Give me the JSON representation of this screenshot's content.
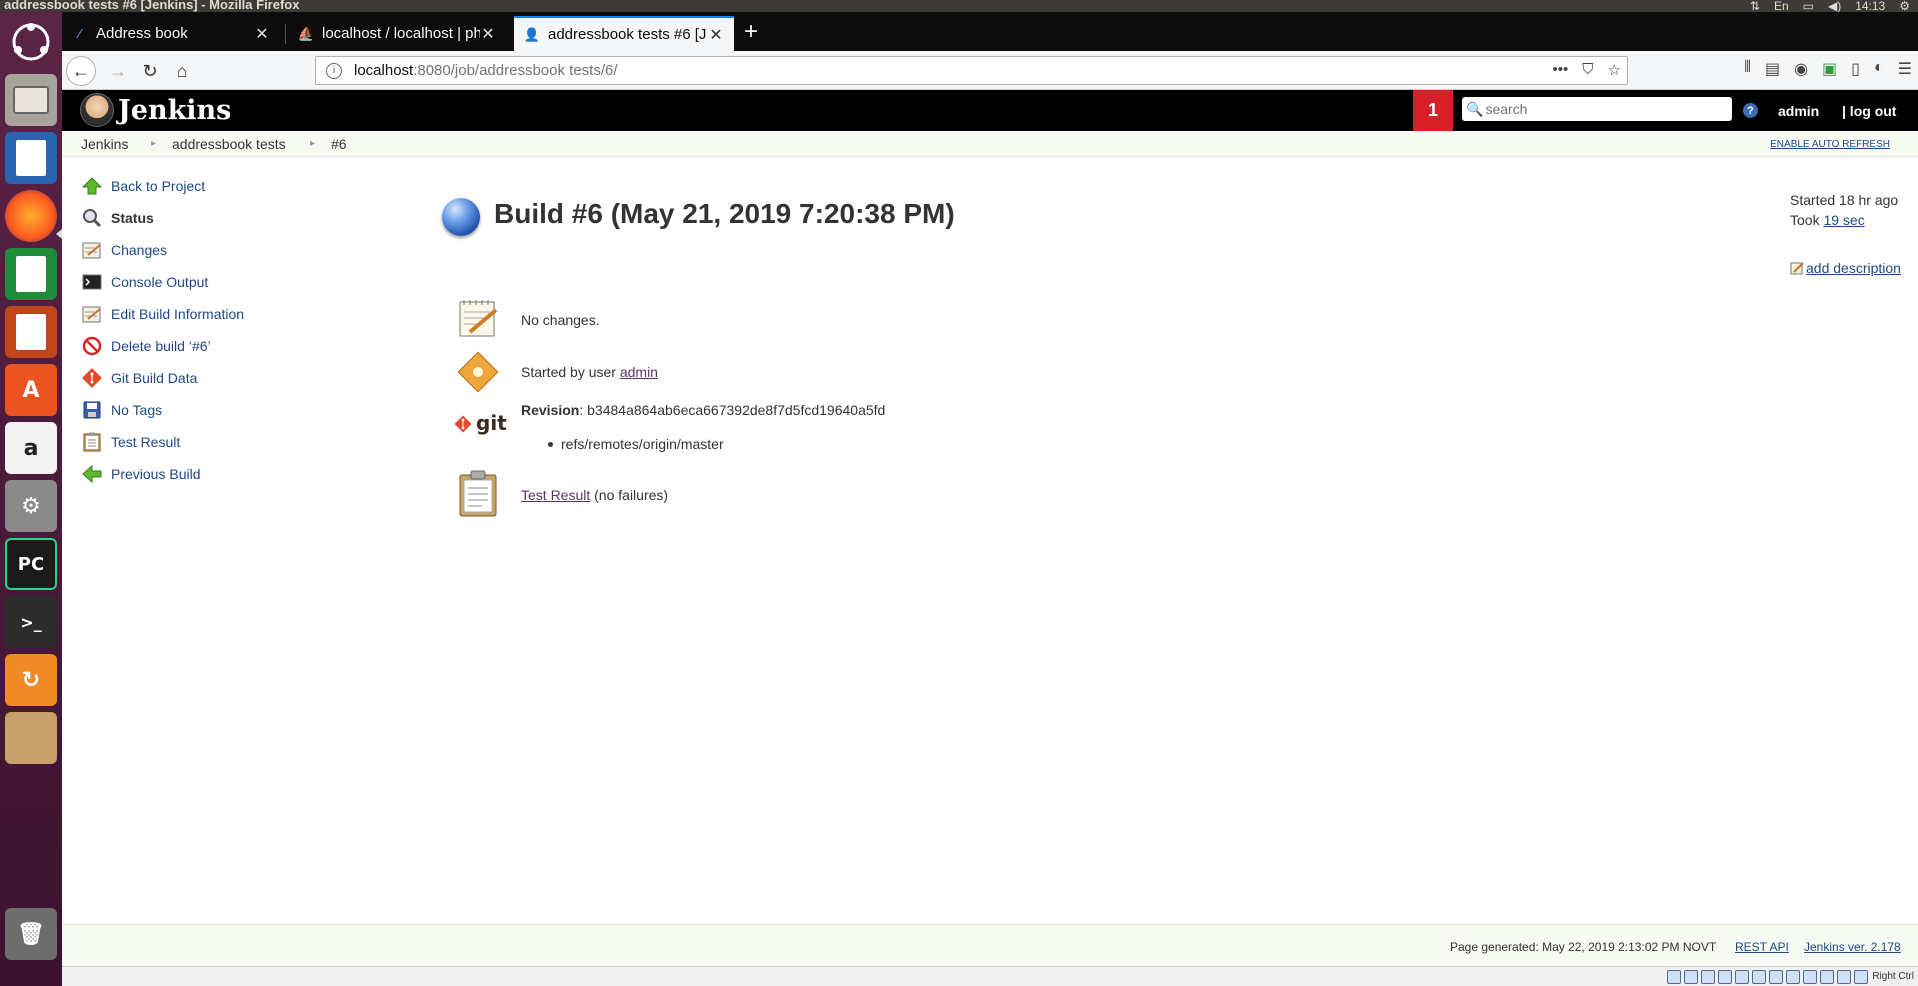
{
  "os": {
    "window_title": "addressbook tests #6 [Jenkins] - Mozilla Firefox",
    "tray": {
      "language": "En",
      "clock": "14:13"
    }
  },
  "browser": {
    "tabs": [
      {
        "label": "Address book",
        "active": false
      },
      {
        "label": "localhost / localhost | ph",
        "active": false
      },
      {
        "label": "addressbook tests #6 [J",
        "active": true
      }
    ],
    "url_host": "localhost",
    "url_rest": ":8080/job/addressbook tests/6/"
  },
  "jenkins": {
    "logo_text": "Jenkins",
    "notification_count": "1",
    "search_placeholder": "search",
    "help": "?",
    "user": "admin",
    "logout": "| log out"
  },
  "breadcrumb": {
    "items": [
      "Jenkins",
      "addressbook tests",
      "#6"
    ],
    "auto_refresh": "ENABLE AUTO REFRESH"
  },
  "side_panel": {
    "tasks": [
      {
        "label": "Back to Project",
        "icon": "up-arrow-icon"
      },
      {
        "label": "Status",
        "icon": "magnifier-icon"
      },
      {
        "label": "Changes",
        "icon": "notepad-icon"
      },
      {
        "label": "Console Output",
        "icon": "terminal-icon"
      },
      {
        "label": "Edit Build Information",
        "icon": "notepad-icon"
      },
      {
        "label": "Delete build ‘#6’",
        "icon": "no-entry-icon"
      },
      {
        "label": "Git Build Data",
        "icon": "git-icon"
      },
      {
        "label": "No Tags",
        "icon": "save-icon"
      },
      {
        "label": "Test Result",
        "icon": "clipboard-icon"
      },
      {
        "label": "Previous Build",
        "icon": "left-arrow-icon"
      }
    ]
  },
  "build": {
    "title": "Build #6 (May 21, 2019 7:20:38 PM)",
    "started_ago": "Started 18 hr ago",
    "took_label": "Took ",
    "took_value": "19 sec",
    "add_description": "add description",
    "changes": "No changes.",
    "started_by_prefix": "Started by user ",
    "started_by_user": "admin",
    "revision_label": "Revision",
    "revision_value": ": b3484a864ab6eca667392de8f7d5fcd19640a5fd",
    "branch": "refs/remotes/origin/master",
    "git_label": "git",
    "test_result_link": "Test Result",
    "test_result_status": " (no failures)"
  },
  "footer": {
    "page_generated": "Page generated: May 22, 2019 2:13:02 PM NOVT",
    "rest_api": "REST API",
    "version": "Jenkins ver. 2.178"
  },
  "statusbar": {
    "right_ctrl": "Right Ctrl"
  },
  "colors": {
    "jenkins_header": "#000000",
    "badge": "#d71f27",
    "link": "#204a87",
    "visited_link": "#5c3566"
  }
}
